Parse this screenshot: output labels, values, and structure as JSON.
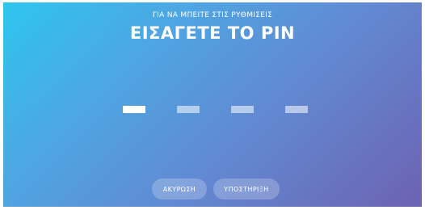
{
  "header": {
    "subtitle": "ΓΙΑ ΝΑ ΜΠΕΙΤΕ ΣΤΙΣ ΡΥΘΜΙΣΕΙΣ",
    "title": "ΕΙΣΑΓΕΤΕ ΤΟ PIN"
  },
  "pin": {
    "length": 4,
    "active_index": 0
  },
  "actions": {
    "cancel_label": "ΑΚΥΡΩΣΗ",
    "support_label": "ΥΠΟΣΤΗΡΙΞΗ"
  },
  "colors": {
    "gradient_start": "#2ec6ee",
    "gradient_end": "#6d62b2",
    "text": "#ffffff"
  }
}
